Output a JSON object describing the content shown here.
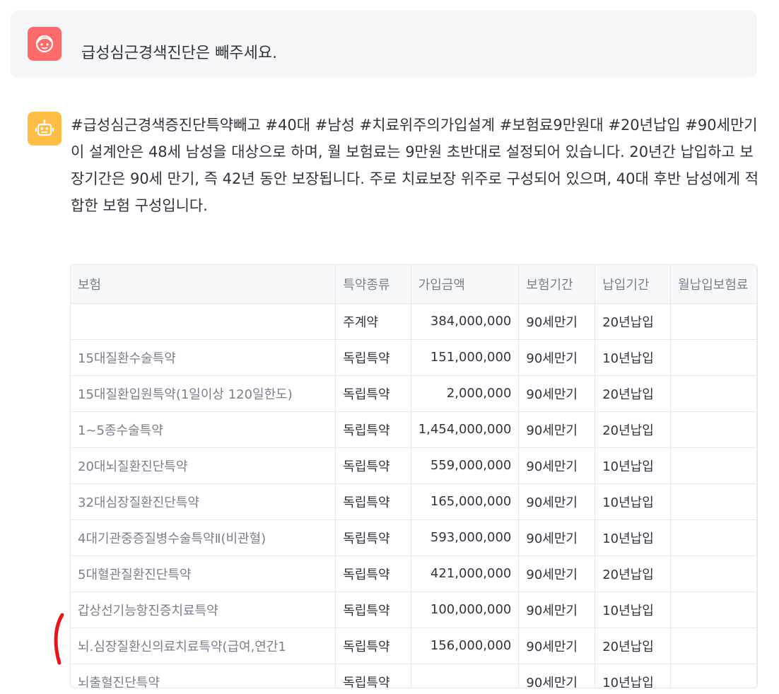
{
  "user_message": {
    "text": "급성심근경색진단은 빼주세요."
  },
  "assistant_message": {
    "hashtags": "#급성심근경색증진단특약빼고 #40대 #남성 #치료위주의가입설계 #보험료9만원대 #20년납입 #90세만기",
    "summary": "이 설계안은 48세 남성을 대상으로 하며, 월 보험료는 9만원 초반대로 설정되어 있습니다. 20년간 납입하고 보장기간은 90세 만기, 즉 42년 동안 보장됩니다. 주로 치료보장 위주로 구성되어 있으며, 40대 후반 남성에게 적합한 보험 구성입니다."
  },
  "table": {
    "columns": [
      "보험",
      "특약종류",
      "가입금액",
      "보험기간",
      "납입기간",
      "월납입보험료"
    ],
    "rows": [
      {
        "name": "",
        "type": "주계약",
        "amount": "384,000,000",
        "period": "90세만기",
        "pay": "20년납입",
        "premium": ""
      },
      {
        "name": "15대질환수술특약",
        "type": "독립특약",
        "amount": "151,000,000",
        "period": "90세만기",
        "pay": "10년납입",
        "premium": ""
      },
      {
        "name": "15대질환입원특약(1일이상 120일한도)",
        "type": "독립특약",
        "amount": "2,000,000",
        "period": "90세만기",
        "pay": "20년납입",
        "premium": ""
      },
      {
        "name": "1~5종수술특약",
        "type": "독립특약",
        "amount": "1,454,000,000",
        "period": "90세만기",
        "pay": "20년납입",
        "premium": ""
      },
      {
        "name": "20대뇌질환진단특약",
        "type": "독립특약",
        "amount": "559,000,000",
        "period": "90세만기",
        "pay": "10년납입",
        "premium": ""
      },
      {
        "name": "32대심장질환진단특약",
        "type": "독립특약",
        "amount": "165,000,000",
        "period": "90세만기",
        "pay": "10년납입",
        "premium": ""
      },
      {
        "name": "4대기관중증질병수술특약Ⅱ(비관혈)",
        "type": "독립특약",
        "amount": "593,000,000",
        "period": "90세만기",
        "pay": "10년납입",
        "premium": ""
      },
      {
        "name": "5대혈관질환진단특약",
        "type": "독립특약",
        "amount": "421,000,000",
        "period": "90세만기",
        "pay": "20년납입",
        "premium": ""
      },
      {
        "name": "갑상선기능항진증치료특약",
        "type": "독립특약",
        "amount": "100,000,000",
        "period": "90세만기",
        "pay": "10년납입",
        "premium": ""
      },
      {
        "name": "뇌.심장질환신의료치료특약(급여,연간1",
        "type": "독립특약",
        "amount": "156,000,000",
        "period": "90세만기",
        "pay": "20년납입",
        "premium": ""
      },
      {
        "name": "뇌출혈진단특약",
        "type": "독립특약",
        "amount": "",
        "period": "90세만기",
        "pay": "10년납입",
        "premium": ""
      }
    ]
  },
  "colors": {
    "user_avatar": "#ff6b6b",
    "bot_avatar": "#ffbd45",
    "annotation": "#e8131b"
  },
  "icons": {
    "user_avatar": "face-icon",
    "bot_avatar": "robot-icon"
  }
}
